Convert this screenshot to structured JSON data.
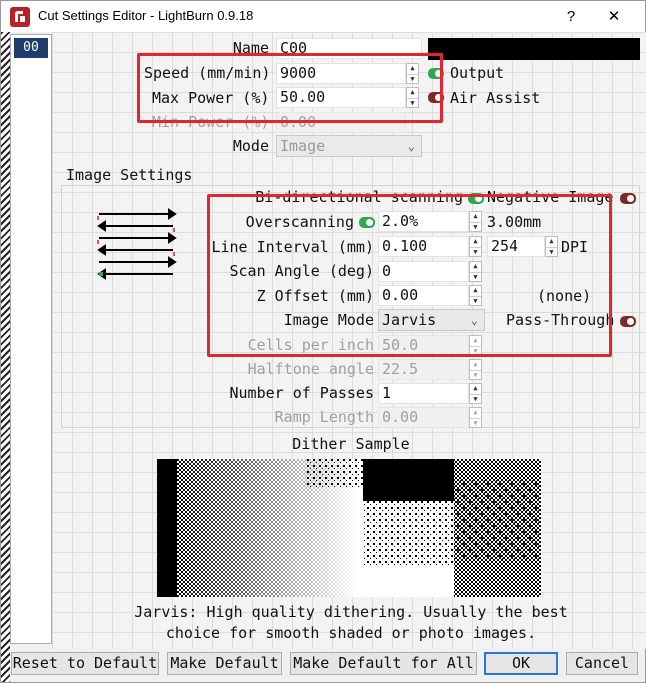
{
  "window": {
    "title": "Cut Settings Editor - LightBurn 0.9.18",
    "help_button": "?",
    "close_button": "✕"
  },
  "layers": [
    "00"
  ],
  "name": {
    "label": "Name",
    "value": "C00"
  },
  "speed": {
    "label": "Speed (mm/min)",
    "value": "9000"
  },
  "max_power": {
    "label": "Max Power (%)",
    "value": "50.00"
  },
  "min_power": {
    "label": "Min Power (%)",
    "value": "0.00"
  },
  "mode": {
    "label": "Mode",
    "value": "Image"
  },
  "output": {
    "label": "Output",
    "state": "on"
  },
  "air_assist": {
    "label": "Air Assist",
    "state": "off"
  },
  "image_settings": {
    "title": "Image Settings",
    "bidirectional": {
      "label": "Bi-directional scanning",
      "state": "on"
    },
    "negative_image": {
      "label": "Negative Image",
      "state": "off"
    },
    "overscanning": {
      "label": "Overscanning",
      "value": "2.0%",
      "state": "on",
      "mm_value": "3.00mm"
    },
    "line_interval": {
      "label": "Line Interval (mm)",
      "value": "0.100",
      "dpi_value": "254",
      "dpi_label": "DPI"
    },
    "scan_angle": {
      "label": "Scan Angle (deg)",
      "value": "0"
    },
    "z_offset": {
      "label": "Z Offset (mm)",
      "value": "0.00",
      "extra": "(none)"
    },
    "image_mode": {
      "label": "Image Mode",
      "value": "Jarvis"
    },
    "pass_through": {
      "label": "Pass-Through",
      "state": "off"
    },
    "cells_per_inch": {
      "label": "Cells per inch",
      "value": "50.0"
    },
    "halftone_angle": {
      "label": "Halftone angle",
      "value": "22.5"
    },
    "number_of_passes": {
      "label": "Number of Passes",
      "value": "1"
    },
    "ramp_length": {
      "label": "Ramp Length",
      "value": "0.00"
    }
  },
  "dither": {
    "title": "Dither Sample",
    "description_line1": "Jarvis: High quality dithering. Usually the best",
    "description_line2": "choice for smooth shaded or photo images."
  },
  "buttons": {
    "reset": "Reset to Default",
    "make_default": "Make Default",
    "make_default_all": "Make Default for All",
    "ok": "OK",
    "cancel": "Cancel"
  },
  "colors": {
    "toggle_on": "#2fa84f",
    "toggle_off": "#7a2a2a",
    "highlight_box": "#e0272e",
    "layer_selected": "#1d3b6b"
  }
}
